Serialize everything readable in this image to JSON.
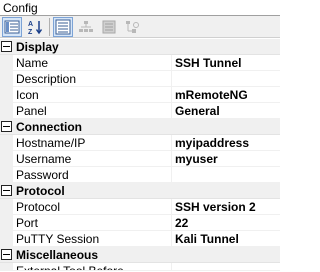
{
  "window": {
    "title": "Config"
  },
  "toolbar": {
    "buttons": [
      {
        "name": "categorized-view-button",
        "icon": "categorized-icon"
      },
      {
        "name": "alphabetical-sort-button",
        "icon": "sort-az-icon"
      },
      {
        "name": "properties-button",
        "icon": "properties-icon"
      },
      {
        "name": "inheritance-button",
        "icon": "inheritance-icon"
      },
      {
        "name": "default-properties-button",
        "icon": "default-properties-icon"
      },
      {
        "name": "default-inheritance-button",
        "icon": "default-inheritance-icon"
      }
    ]
  },
  "grid": {
    "categories": [
      {
        "label": "Display",
        "rows": [
          {
            "name": "Name",
            "value": "SSH Tunnel"
          },
          {
            "name": "Description",
            "value": ""
          },
          {
            "name": "Icon",
            "value": "mRemoteNG"
          },
          {
            "name": "Panel",
            "value": "General"
          }
        ]
      },
      {
        "label": "Connection",
        "rows": [
          {
            "name": "Hostname/IP",
            "value": "myipaddress"
          },
          {
            "name": "Username",
            "value": "myuser"
          },
          {
            "name": "Password",
            "value": ""
          }
        ]
      },
      {
        "label": "Protocol",
        "rows": [
          {
            "name": "Protocol",
            "value": "SSH version 2"
          },
          {
            "name": "Port",
            "value": "22"
          },
          {
            "name": "PuTTY Session",
            "value": "Kali Tunnel"
          }
        ]
      },
      {
        "label": "Miscellaneous",
        "rows": [
          {
            "name": "External Tool Before",
            "value": ""
          }
        ]
      }
    ]
  }
}
